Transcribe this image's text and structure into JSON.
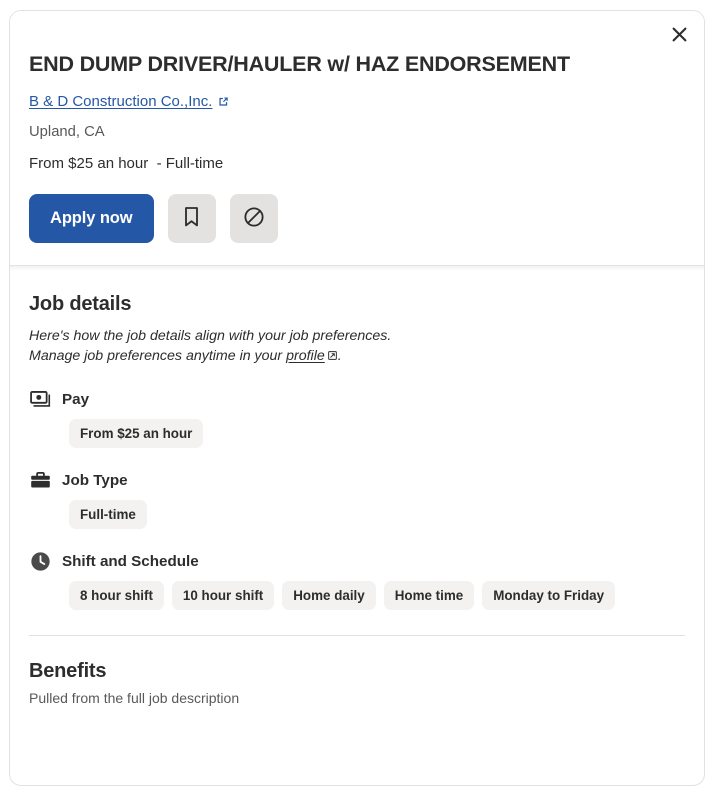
{
  "header": {
    "close_label": "×",
    "close_icon": "close-icon",
    "job_title": "END DUMP DRIVER/HAULER w/ HAZ ENDORSEMENT",
    "company_name": "B & D Construction Co.,Inc.",
    "company_ext_icon": "external-link-icon",
    "location": "Upland, CA",
    "salary_summary": "From $25 an hour  - Full-time"
  },
  "actions": {
    "apply_label": "Apply now",
    "save_icon": "bookmark-icon",
    "not_interested_icon": "block-icon"
  },
  "job_details": {
    "title": "Job details",
    "intro_line1": "Here's how the job details align with your job preferences.",
    "intro_line2_prefix": "Manage job preferences anytime in your ",
    "intro_link": "profile",
    "intro_link_icon": "external-link-icon",
    "intro_line2_suffix": ".",
    "groups": [
      {
        "icon": "money-icon",
        "label": "Pay",
        "chips": [
          "From $25 an hour"
        ]
      },
      {
        "icon": "briefcase-icon",
        "label": "Job Type",
        "chips": [
          "Full-time"
        ]
      },
      {
        "icon": "clock-icon",
        "label": "Shift and Schedule",
        "chips": [
          "8 hour shift",
          "10 hour shift",
          "Home daily",
          "Home time",
          "Monday to Friday"
        ]
      }
    ]
  },
  "benefits": {
    "title": "Benefits",
    "subtitle": "Pulled from the full job description"
  },
  "colors": {
    "accent_blue": "#2557a7",
    "chip_bg": "#f3f2f1",
    "text_primary": "#2d2d2d",
    "text_muted": "#595959",
    "border": "#e4e2e0"
  }
}
